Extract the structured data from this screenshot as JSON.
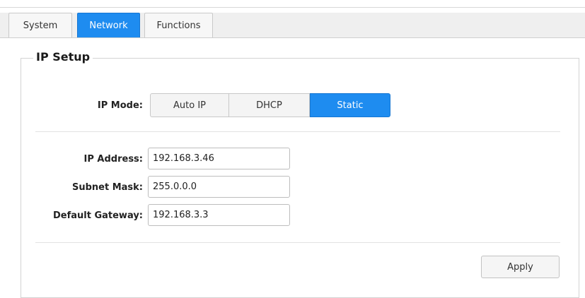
{
  "tabs": [
    {
      "label": "System",
      "active": false
    },
    {
      "label": "Network",
      "active": true
    },
    {
      "label": "Functions",
      "active": false
    }
  ],
  "ip_setup": {
    "legend": "IP Setup",
    "mode_label": "IP Mode:",
    "modes": [
      {
        "label": "Auto IP",
        "selected": false
      },
      {
        "label": "DHCP",
        "selected": false
      },
      {
        "label": "Static",
        "selected": true
      }
    ],
    "fields": {
      "ip_address": {
        "label": "IP Address:",
        "value": "192.168.3.46"
      },
      "subnet_mask": {
        "label": "Subnet Mask:",
        "value": "255.0.0.0"
      },
      "default_gateway": {
        "label": "Default Gateway:",
        "value": "192.168.3.3"
      }
    },
    "apply_label": "Apply"
  },
  "colors": {
    "accent": "#1e8cf0",
    "tabbar_bg": "#efefef",
    "border": "#d3d3d3"
  }
}
